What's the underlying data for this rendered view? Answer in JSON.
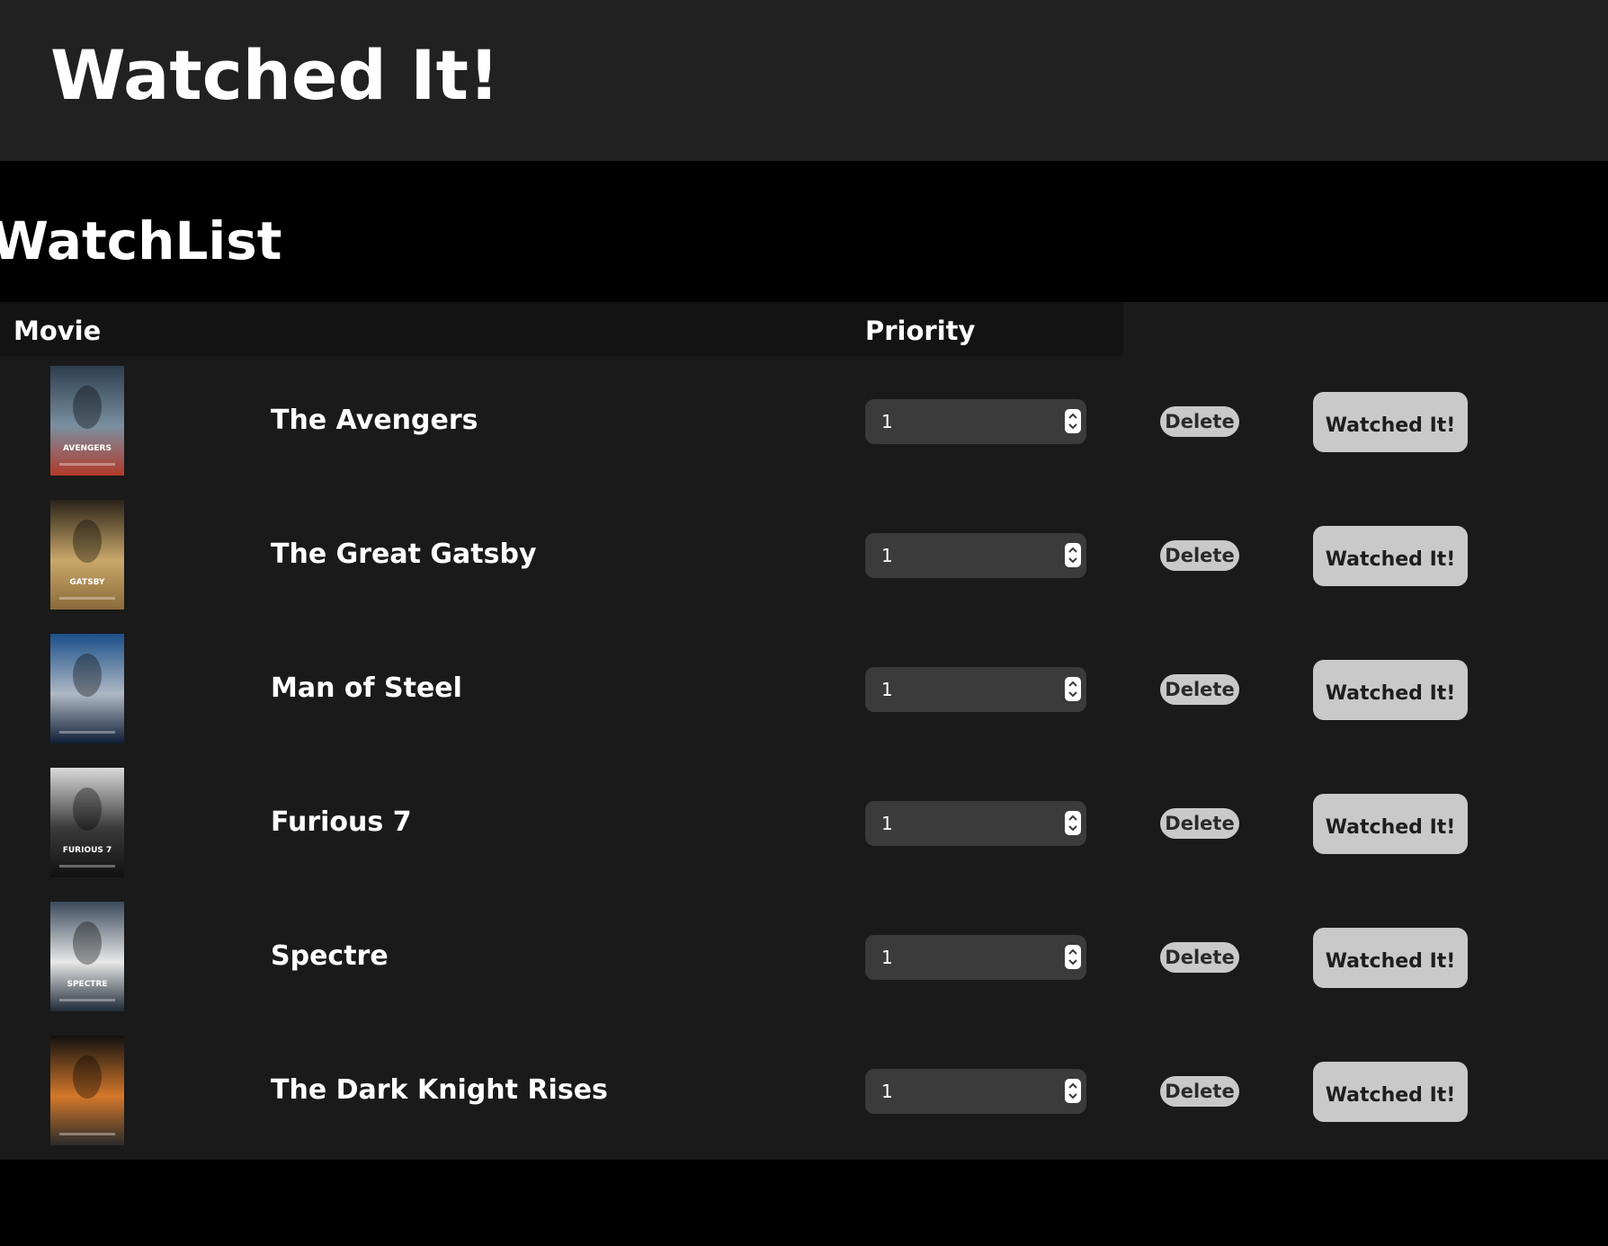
{
  "header": {
    "title": "Watched It!"
  },
  "watchlist": {
    "title": "WatchList",
    "columns": {
      "movie": "Movie",
      "priority": "Priority"
    },
    "delete_label": "Delete",
    "watched_label": "Watched It!",
    "rows": [
      {
        "title": "The Avengers",
        "priority": "1",
        "poster": {
          "colors": [
            "#2c3e4e",
            "#7a8fa0",
            "#b23a2a"
          ],
          "caption": "AVENGERS"
        }
      },
      {
        "title": "The Great Gatsby",
        "priority": "1",
        "poster": {
          "colors": [
            "#2a2218",
            "#c9a86a",
            "#8a6b3a"
          ],
          "caption": "GATSBY"
        }
      },
      {
        "title": "Man of Steel",
        "priority": "1",
        "poster": {
          "colors": [
            "#1b4f8a",
            "#aeb8c4",
            "#0e1e35"
          ],
          "caption": ""
        }
      },
      {
        "title": "Furious 7",
        "priority": "1",
        "poster": {
          "colors": [
            "#dadada",
            "#3a3a3a",
            "#111111"
          ],
          "caption": "FURIOUS 7"
        }
      },
      {
        "title": "Spectre",
        "priority": "1",
        "poster": {
          "colors": [
            "#3a4a5c",
            "#e8e8e8",
            "#1e2a38"
          ],
          "caption": "SPECTRE"
        }
      },
      {
        "title": "The Dark Knight Rises",
        "priority": "1",
        "poster": {
          "colors": [
            "#101010",
            "#d4782a",
            "#2b2b2b"
          ],
          "caption": ""
        }
      }
    ]
  }
}
